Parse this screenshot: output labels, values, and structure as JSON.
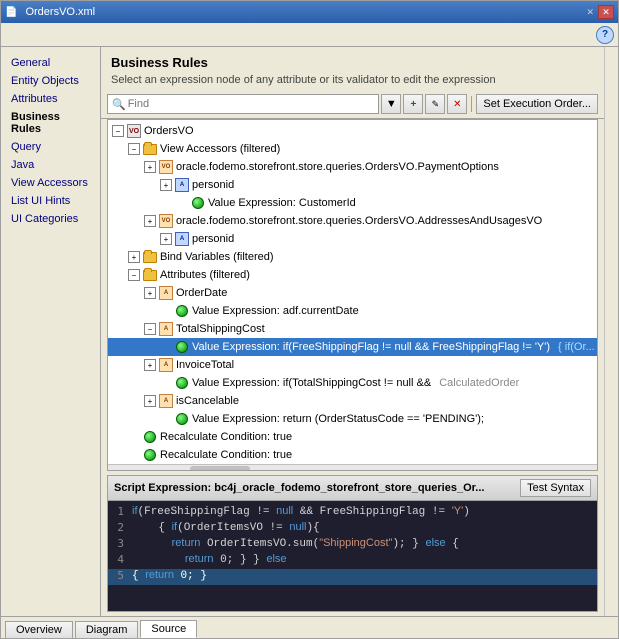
{
  "window": {
    "title": "OrdersVO.xml"
  },
  "nav": {
    "items": [
      {
        "label": "General",
        "active": false
      },
      {
        "label": "Entity Objects",
        "active": false
      },
      {
        "label": "Attributes",
        "active": false
      },
      {
        "label": "Business Rules",
        "active": true
      },
      {
        "label": "Query",
        "active": false
      },
      {
        "label": "Java",
        "active": false
      },
      {
        "label": "View Accessors",
        "active": false
      },
      {
        "label": "List UI Hints",
        "active": false
      },
      {
        "label": "UI Categories",
        "active": false
      }
    ]
  },
  "panel": {
    "title": "Business Rules",
    "subtitle": "Select an expression node of any attribute or its validator to edit the expression"
  },
  "toolbar": {
    "search_placeholder": "Find",
    "set_exec_order": "Set Execution Order..."
  },
  "tree": {
    "root": "OrdersVO",
    "nodes": [
      {
        "indent": 0,
        "label": "OrdersVO",
        "type": "vo"
      },
      {
        "indent": 1,
        "label": "View Accessors (filtered)",
        "type": "folder"
      },
      {
        "indent": 2,
        "label": "oracle.fodemo.storefront.store.queries.OrdersVO.PaymentOptions",
        "type": "xml"
      },
      {
        "indent": 3,
        "label": "personid",
        "type": "attr"
      },
      {
        "indent": 4,
        "label": "Value Expression: CustomerId",
        "type": "green"
      },
      {
        "indent": 2,
        "label": "oracle.fodemo.storefront.store.queries.OrdersVO.AddressesAndUsagesVO",
        "type": "xml"
      },
      {
        "indent": 3,
        "label": "personid",
        "type": "attr"
      },
      {
        "indent": 1,
        "label": "Bind Variables (filtered)",
        "type": "folder"
      },
      {
        "indent": 1,
        "label": "Attributes (filtered)",
        "type": "folder"
      },
      {
        "indent": 2,
        "label": "OrderDate",
        "type": "attr-xml"
      },
      {
        "indent": 3,
        "label": "Value Expression: adf.currentDate",
        "type": "green"
      },
      {
        "indent": 2,
        "label": "TotalShippingCost",
        "type": "attr-xml"
      },
      {
        "indent": 2,
        "label": "Value Expression: if(FreeShippingFlag != null && FreeShippingFlag != 'Y')",
        "type": "green",
        "selected": true,
        "extra": "{ if(Or..."
      },
      {
        "indent": 2,
        "label": "InvoiceTotal",
        "type": "attr-xml"
      },
      {
        "indent": 3,
        "label": "Value Expression: if(TotalShippingCost != null &&",
        "type": "green",
        "extra": "CalculatedOrder"
      },
      {
        "indent": 2,
        "label": "isCancelable",
        "type": "attr-xml"
      },
      {
        "indent": 3,
        "label": "Value Expression: return (OrderStatusCode == 'PENDING');",
        "type": "green"
      },
      {
        "indent": 1,
        "label": "Recalculate Condition: true",
        "type": "green-top"
      },
      {
        "indent": 1,
        "label": "Recalculate Condition: true",
        "type": "green-top"
      }
    ]
  },
  "script": {
    "header": "Script Expression: bc4j_oracle_fodemo_storefront_store_queries_Or...",
    "test_syntax_btn": "Test Syntax",
    "lines": [
      {
        "num": "1",
        "code": "if(FreeShippingFlag != null && FreeShippingFlag != 'Y')"
      },
      {
        "num": "2",
        "code": "  { if(OrderItemsVO != null){"
      },
      {
        "num": "3",
        "code": "    return OrderItemsVO.sum(\"ShippingCost\"); } else {"
      },
      {
        "num": "4",
        "code": "      return 0; } } else"
      },
      {
        "num": "5",
        "code": "{ return 0; }"
      }
    ]
  },
  "tabs": {
    "items": [
      {
        "label": "Overview",
        "active": false
      },
      {
        "label": "Diagram",
        "active": false
      },
      {
        "label": "Source",
        "active": true
      }
    ]
  }
}
